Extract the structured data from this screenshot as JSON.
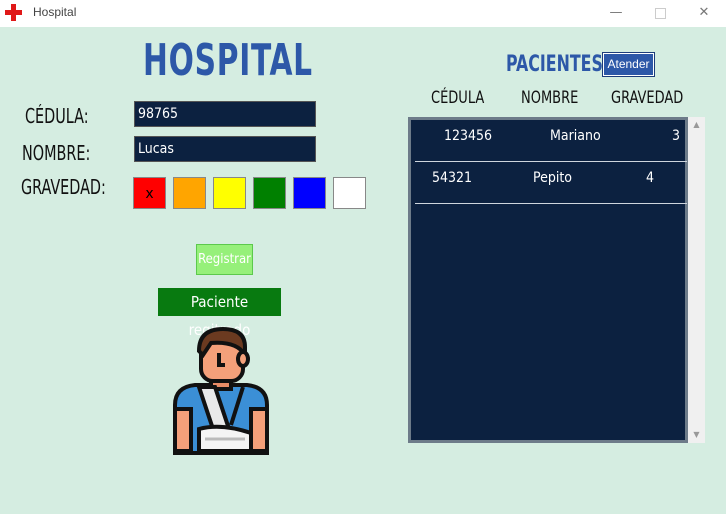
{
  "window": {
    "title": "Hospital"
  },
  "header": {
    "title": "HOSPITAL"
  },
  "form": {
    "cedula_label": "CÉDULA:",
    "cedula_value": "98765",
    "nombre_label": "NOMBRE:",
    "nombre_value": "Lucas",
    "gravedad_label": "GRAVEDAD:",
    "gravedad_options": [
      {
        "color": "#ff0000",
        "mark": "x"
      },
      {
        "color": "#ffa500",
        "mark": ""
      },
      {
        "color": "#ffff00",
        "mark": ""
      },
      {
        "color": "#008000",
        "mark": ""
      },
      {
        "color": "#0000ff",
        "mark": ""
      },
      {
        "color": "#ffffff",
        "mark": ""
      }
    ],
    "register_label": "Registrar",
    "status_message": "Paciente regitrado"
  },
  "patients": {
    "title": "PACIENTES",
    "attend_label": "Atender",
    "columns": [
      "CÉDULA",
      "NOMBRE",
      "GRAVEDAD"
    ],
    "rows": [
      {
        "cedula": "123456",
        "nombre": "Mariano",
        "gravedad": "3"
      },
      {
        "cedula": "54321",
        "nombre": "Pepito",
        "gravedad": "4"
      }
    ]
  }
}
